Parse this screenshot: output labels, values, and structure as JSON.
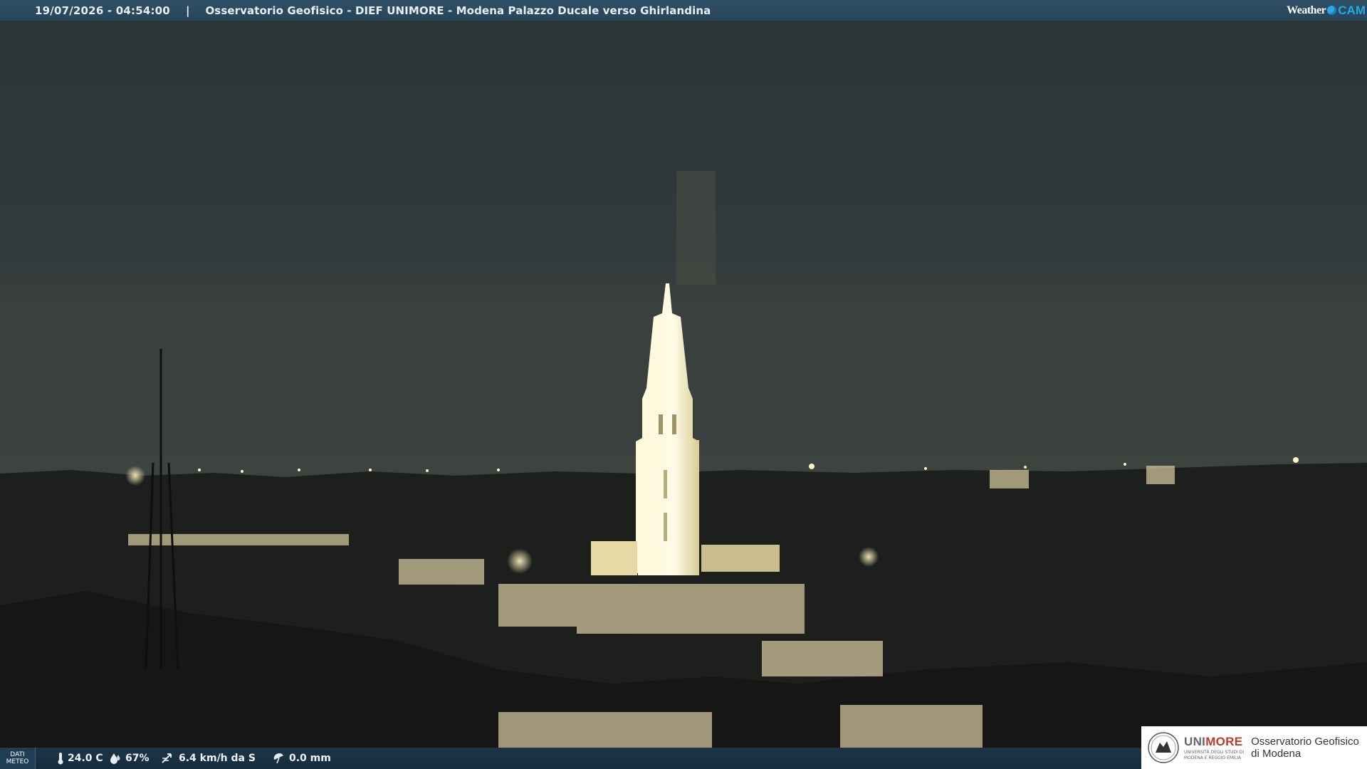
{
  "header": {
    "datetime": "19/07/2026 - 04:54:00",
    "separator": "|",
    "title": "Osservatorio Geofisico - DIEF UNIMORE - Modena Palazzo Ducale verso Ghirlandina"
  },
  "brand": {
    "weather": "Weather",
    "cam": "CAM",
    "accent_color": "#29a9e1"
  },
  "meteo": {
    "button_line1": "DATI",
    "button_line2": "METEO",
    "temperature": "24.0 C",
    "humidity": "67%",
    "wind": "6.4 km/h da S",
    "rain": "0.0 mm"
  },
  "icons": [
    "thermometer-icon",
    "humidity-drop-icon",
    "wind-icon",
    "rain-umbrella-icon",
    "unimore-seal-icon",
    "weathercam-dot-icon"
  ],
  "logo": {
    "uni_part1": "UNI",
    "uni_part2": "MORE",
    "uni_sub1": "UNIVERSITÀ DEGLI STUDI DI",
    "uni_sub2": "MODENA E REGGIO EMILIA",
    "obs_line1": "Osservatorio Geofisico",
    "obs_line2": "di Modena",
    "red": "#c0392b"
  }
}
